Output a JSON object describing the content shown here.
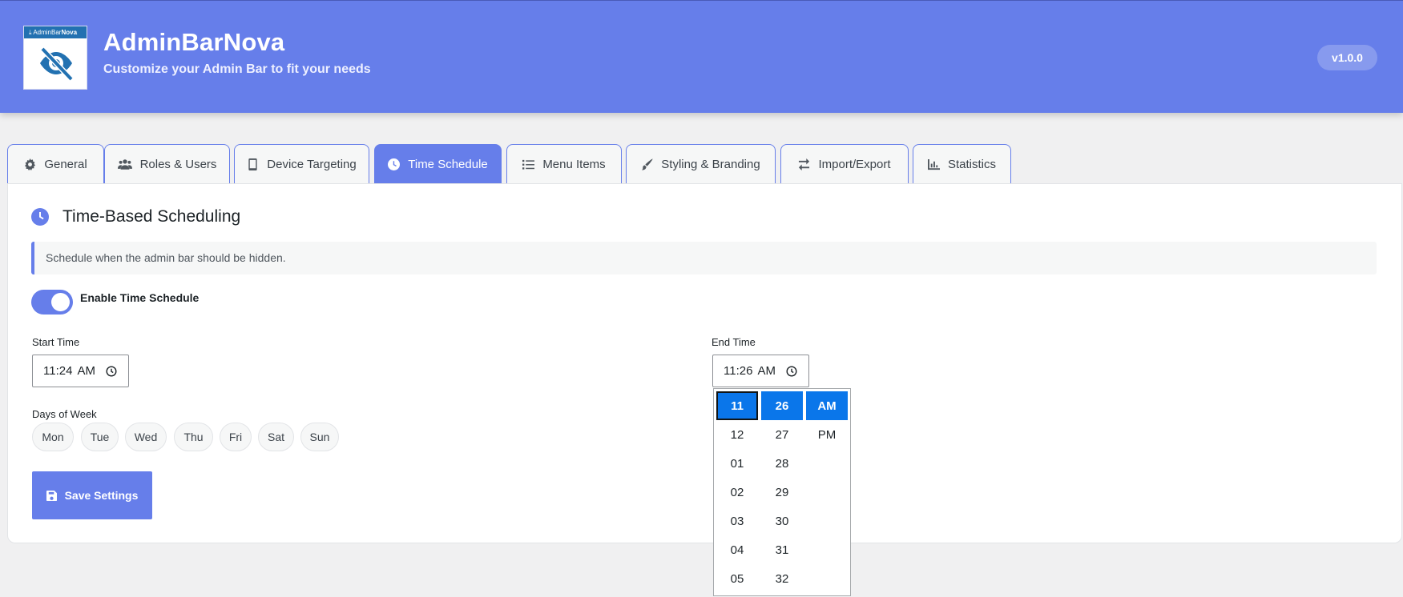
{
  "header": {
    "logo_band_prefix": "AdminBar",
    "logo_band_suffix": "Nova",
    "title": "AdminBarNova",
    "subtitle": "Customize your Admin Bar to fit your needs",
    "version": "v1.0.0",
    "background_color": "#667eea"
  },
  "tabs": [
    {
      "label": "General",
      "icon": "gear-icon"
    },
    {
      "label": "Roles & Users",
      "icon": "users-icon"
    },
    {
      "label": "Device Targeting",
      "icon": "mobile-icon"
    },
    {
      "label": "Time Schedule",
      "icon": "clock-icon",
      "active": true
    },
    {
      "label": "Menu Items",
      "icon": "list-icon"
    },
    {
      "label": "Styling & Branding",
      "icon": "brush-icon"
    },
    {
      "label": "Import/Export",
      "icon": "exchange-icon"
    },
    {
      "label": "Statistics",
      "icon": "chart-icon"
    }
  ],
  "section": {
    "title": "Time-Based Scheduling",
    "notice": "Schedule when the admin bar should be hidden."
  },
  "schedule_toggle": {
    "label": "Enable Time Schedule",
    "enabled": true
  },
  "start_time": {
    "label": "Start Time",
    "value": "11:24",
    "meridiem": "AM"
  },
  "end_time": {
    "label": "End Time",
    "value": "11:26",
    "meridiem": "AM"
  },
  "days": {
    "label": "Days of Week",
    "items": [
      "Mon",
      "Tue",
      "Wed",
      "Thu",
      "Fri",
      "Sat",
      "Sun"
    ]
  },
  "save_button": {
    "label": "Save Settings",
    "icon": "save-icon"
  },
  "time_picker": {
    "hours": [
      "11",
      "12",
      "01",
      "02",
      "03",
      "04",
      "05"
    ],
    "minutes": [
      "26",
      "27",
      "28",
      "29",
      "30",
      "31",
      "32"
    ],
    "meridiem": [
      "AM",
      "PM"
    ],
    "selected_hour": "11",
    "selected_minute": "26",
    "selected_meridiem": "AM",
    "selection_color": "#0a76ea"
  }
}
